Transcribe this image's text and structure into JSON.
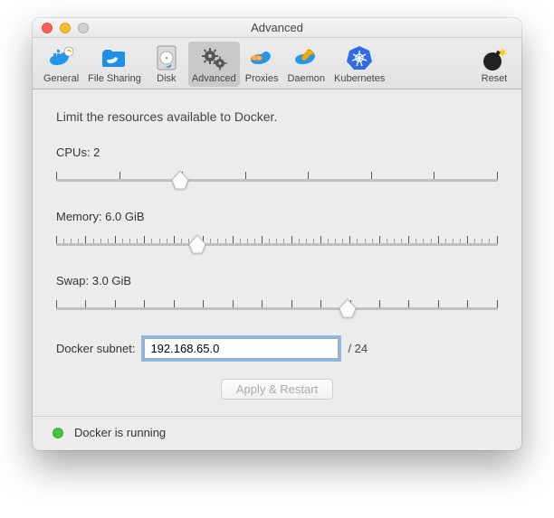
{
  "title": "Advanced",
  "toolbar": {
    "items": [
      {
        "label": "General"
      },
      {
        "label": "File Sharing"
      },
      {
        "label": "Disk"
      },
      {
        "label": "Advanced"
      },
      {
        "label": "Proxies"
      },
      {
        "label": "Daemon"
      },
      {
        "label": "Kubernetes"
      }
    ],
    "reset_label": "Reset",
    "selected_index": 3
  },
  "lead_text": "Limit the resources available to Docker.",
  "cpus": {
    "label": "CPUs: 2",
    "value_percent": 28
  },
  "memory": {
    "label": "Memory: 6.0 GiB",
    "value_percent": 32
  },
  "swap": {
    "label": "Swap: 3.0 GiB",
    "value_percent": 66
  },
  "subnet": {
    "label": "Docker subnet:",
    "value": "192.168.65.0",
    "suffix": "/ 24"
  },
  "apply_label": "Apply & Restart",
  "status_text": "Docker is running"
}
